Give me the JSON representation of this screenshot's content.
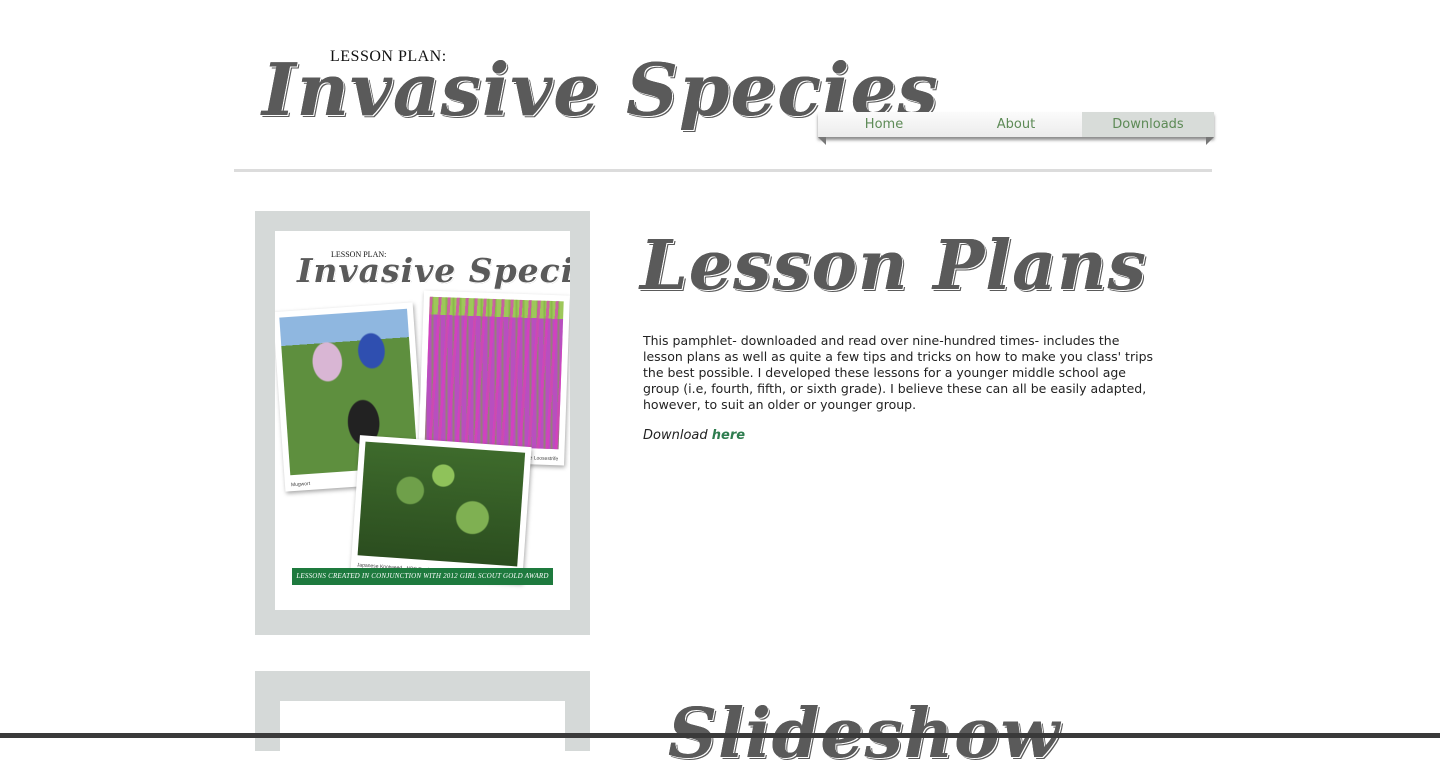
{
  "header": {
    "kicker": "LESSON PLAN:",
    "title": "Invasive Species"
  },
  "nav": {
    "items": [
      {
        "label": "Home",
        "active": false
      },
      {
        "label": "About",
        "active": false
      },
      {
        "label": "Downloads",
        "active": true
      }
    ]
  },
  "cover": {
    "kicker": "LESSON PLAN:",
    "title": "Invasive Species",
    "captions": {
      "mugwort": "Mugwort",
      "loosestrife": "Purple Loosestrife",
      "knotweed": "Japanese Knotweed - NPS Exotic Plant Management Team"
    },
    "banner": "LESSONS CREATED IN CONJUNCTION WITH 2012 GIRL SCOUT GOLD AWARD"
  },
  "section": {
    "title": "Lesson Plans",
    "body": "This pamphlet- downloaded and read over nine-hundred times- includes the lesson plans as well as quite a few tips and tricks on how to make you class' trips the best possible. I developed these lessons for a younger middle school age group (i.e, fourth, fifth, or sixth grade). I believe these can all be easily adapted, however, to suit an older or younger group.",
    "download_prefix": "Download ",
    "download_link": "here"
  },
  "section2": {
    "title": "Slideshow"
  },
  "colors": {
    "nav_text": "#5d8a56",
    "link": "#2e7d4f",
    "frame": "#d5d9d8",
    "banner": "#1e7a3e"
  }
}
